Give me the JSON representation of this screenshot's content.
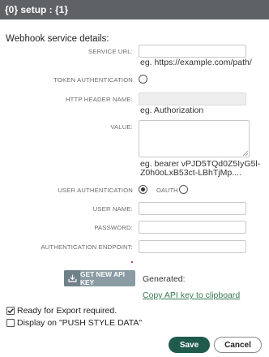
{
  "dialog": {
    "title": "{0} setup : {1}"
  },
  "section": {
    "title": "Webhook service details:"
  },
  "fields": {
    "service_url": {
      "label": "SERVICE URL:",
      "value": "",
      "hint": "eg. https://example.com/path/"
    },
    "token_auth": {
      "label": "TOKEN AUTHENTICATION",
      "checked": false
    },
    "http_header_name": {
      "label": "HTTP HEADER NAME:",
      "value": "",
      "hint": "eg. Authorization"
    },
    "value": {
      "label": "VALUE:",
      "value": "",
      "hint_line1": "eg. bearer vPJD5TQd0Z5IyG5l-",
      "hint_line2": "Z0h0oLxB53ct-LBhTjMp...."
    },
    "user_auth": {
      "label": "USER AUTHENTICATION",
      "checked": true,
      "oauth_label": "OAUTH",
      "oauth_checked": false
    },
    "user_name": {
      "label": "USER NAME:",
      "value": ""
    },
    "password": {
      "label": "PASSWORD:",
      "value": ""
    },
    "auth_endpoint": {
      "label": "AUTHENTICATION ENDPOINT:",
      "value": ""
    }
  },
  "api_key": {
    "button_label": "GET NEW API KEY",
    "generated_label": "Generated:",
    "copy_link": "Copy API key to clipboard"
  },
  "options": {
    "ready_for_export": {
      "label": "Ready for Export required.",
      "checked": true
    },
    "display_push": {
      "label": "Display on \"PUSH STYLE DATA\"",
      "checked": false
    }
  },
  "footer": {
    "save_label": "Save",
    "cancel_label": "Cancel"
  },
  "colors": {
    "titlebar": "#5f6264",
    "save": "#1f5a4c",
    "link": "#3a7a56",
    "api_button": "#8a9ba3"
  }
}
